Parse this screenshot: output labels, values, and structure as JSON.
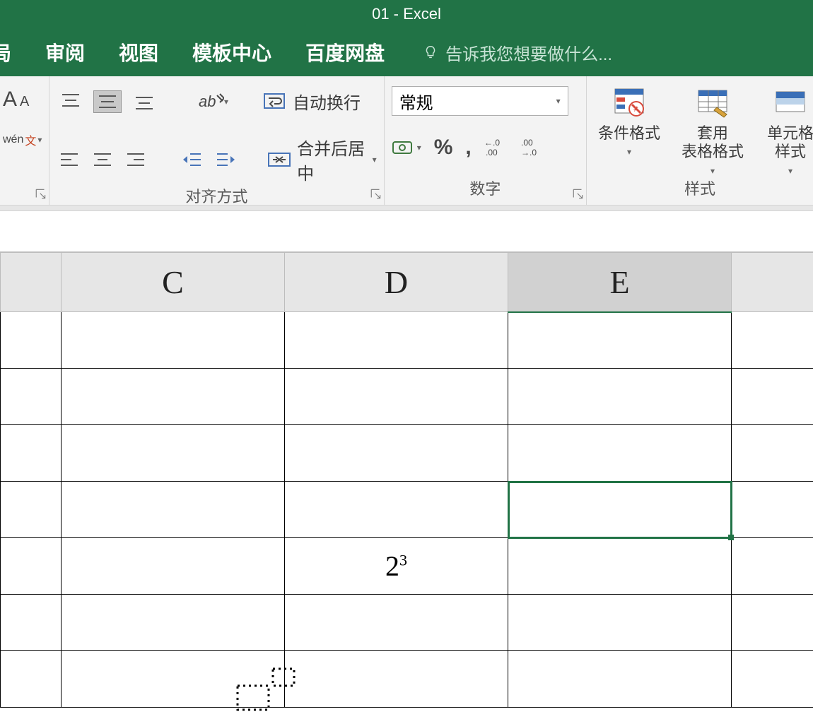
{
  "title": "01 - Excel",
  "tabs": {
    "partial": "局",
    "review": "审阅",
    "view": "视图",
    "templates": "模板中心",
    "baidu": "百度网盘"
  },
  "tellme_placeholder": "告诉我您想要做什么...",
  "ribbon": {
    "font": {
      "wen_label": "wén"
    },
    "alignment": {
      "label": "对齐方式",
      "wrap": "自动换行",
      "merge": "合并后居中"
    },
    "number": {
      "label": "数字",
      "format_selected": "常规",
      "percent": "%",
      "comma": ","
    },
    "styles": {
      "label": "样式",
      "conditional": "条件格式",
      "table_format": "套用\n表格格式",
      "cell_styles": "单元格样式"
    }
  },
  "columns": {
    "c": "C",
    "d": "D",
    "e": "E"
  },
  "cells": {
    "d5_base": "2",
    "d5_exp": "3"
  }
}
